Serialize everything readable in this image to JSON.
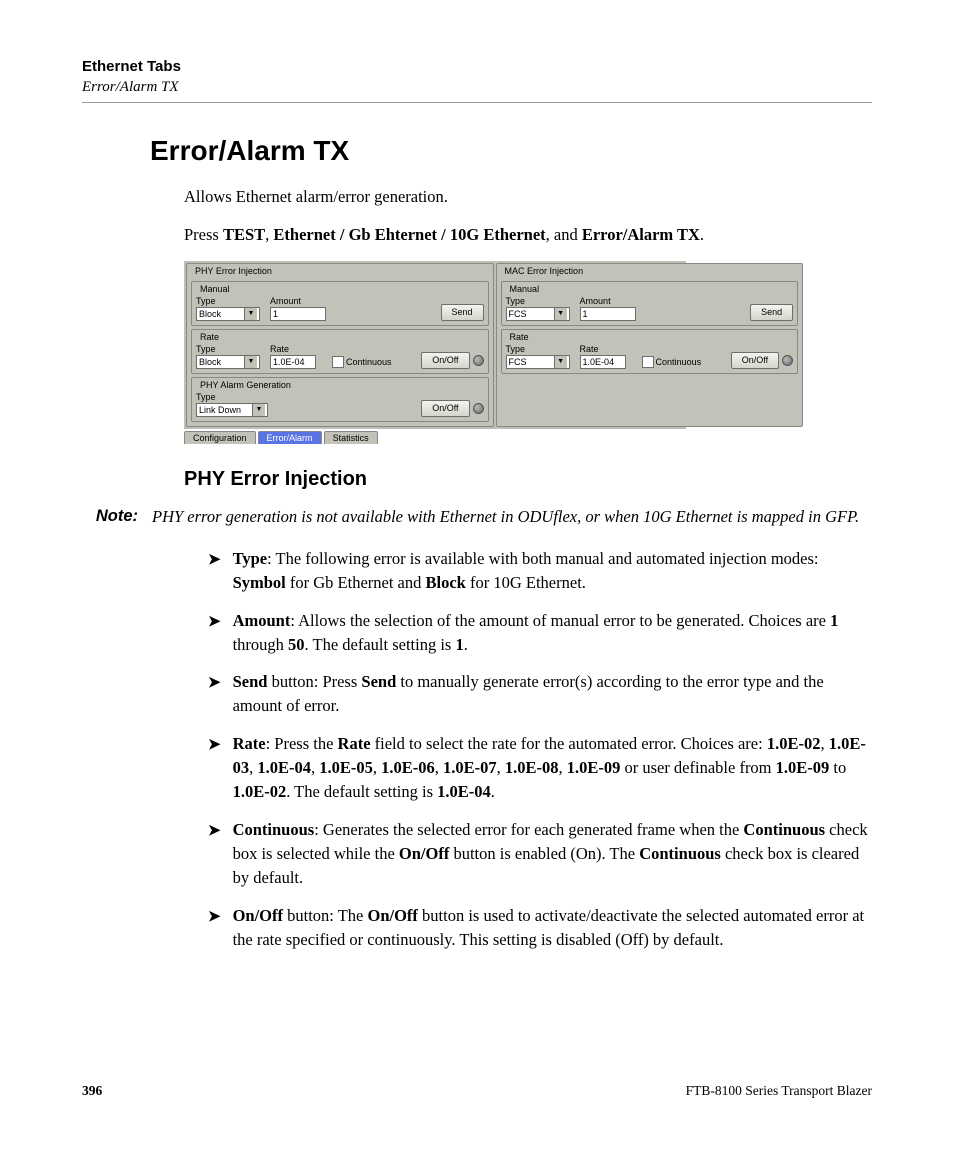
{
  "running_head": {
    "chapter": "Ethernet Tabs",
    "section": "Error/Alarm TX"
  },
  "title": "Error/Alarm TX",
  "intro1": "Allows Ethernet alarm/error generation.",
  "intro2": {
    "pre": "Press ",
    "b1": "TEST",
    "mid1": ", ",
    "b2": "Ethernet / Gb Ehternet / 10G Ethernet",
    "mid2": ", and ",
    "b3": "Error/Alarm TX",
    "post": "."
  },
  "ui": {
    "phy_group": "PHY Error Injection",
    "mac_group": "MAC Error Injection",
    "sub_manual": "Manual",
    "sub_rate": "Rate",
    "alarm_group": "PHY Alarm Generation",
    "lbl_type": "Type",
    "lbl_amount": "Amount",
    "lbl_rate": "Rate",
    "val_block": "Block",
    "val_fcs": "FCS",
    "val_amount": "1",
    "val_rate": "1.0E-04",
    "chk_cont": "Continuous",
    "btn_send": "Send",
    "btn_onoff": "On/Off",
    "val_linkdown": "Link Down",
    "tab_config": "Configuration",
    "tab_err": "Error/Alarm",
    "tab_stats": "Statistics"
  },
  "sub_heading": "PHY Error Injection",
  "note": {
    "label": "Note:",
    "text": "PHY error generation is not available with Ethernet in ODUflex, or when 10G Ethernet is mapped in GFP."
  },
  "bullets": {
    "type": {
      "b1": "Type",
      "t1": ": The following error is available with both manual and automated injection modes: ",
      "b2": "Symbol",
      "t2": " for Gb Ethernet and ",
      "b3": "Block",
      "t3": " for 10G Ethernet."
    },
    "amount": {
      "b1": "Amount",
      "t1": ": Allows the selection of the amount of manual error to be generated. Choices are ",
      "b2": "1",
      "t2": " through ",
      "b3": "50",
      "t3": ". The default setting is ",
      "b4": "1",
      "t4": "."
    },
    "send": {
      "b1": "Send",
      "t1": " button: Press ",
      "b2": "Send",
      "t2": " to manually generate error(s) according to the error type and the amount of error."
    },
    "rate": {
      "b1": "Rate",
      "t1": ": Press the ",
      "b2": "Rate",
      "t2": " field to select the rate for the automated error. Choices are: ",
      "b3": "1.0E-02",
      "c1": ", ",
      "b4": "1.0E-03",
      "c2": ", ",
      "b5": "1.0E-04",
      "c3": ", ",
      "b6": "1.0E-05",
      "c4": ", ",
      "b7": "1.0E-06",
      "c5": ", ",
      "b8": "1.0E-07",
      "c6": ", ",
      "b9": "1.0E-08",
      "c7": ", ",
      "b10": "1.0E-09",
      "t3": " or user definable from ",
      "b11": "1.0E-09",
      "t4": " to ",
      "b12": "1.0E-02",
      "t5": ". The default setting is ",
      "b13": "1.0E-04",
      "t6": "."
    },
    "cont": {
      "b1": "Continuous",
      "t1": ": Generates the selected error for each generated frame when the ",
      "b2": "Continuous",
      "t2": " check box is selected while the ",
      "b3": "On/Off",
      "t3": " button is enabled (On). The ",
      "b4": "Continuous",
      "t4": " check box is cleared by default."
    },
    "onoff": {
      "b1": "On/Off",
      "t1": " button: The ",
      "b2": "On/Off",
      "t2": " button is used to activate/deactivate the selected automated error at the rate specified or continuously. This setting is disabled (Off) by default."
    }
  },
  "footer": {
    "page": "396",
    "product": "FTB-8100 Series Transport Blazer"
  }
}
